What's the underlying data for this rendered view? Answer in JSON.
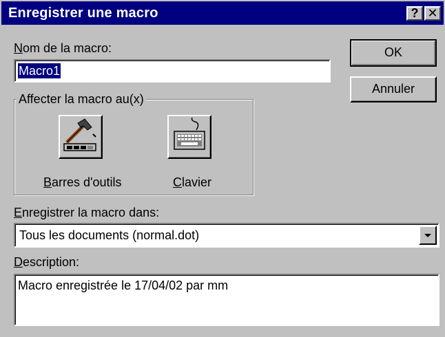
{
  "window": {
    "title": "Enregistrer une macro",
    "help_label": "?",
    "close_label": "✕"
  },
  "macro_name": {
    "label_prefix": "N",
    "label_rest": "om de la macro:",
    "value": "Macro1"
  },
  "buttons": {
    "ok": "OK",
    "cancel": "Annuler"
  },
  "assign_group": {
    "title": "Affecter la macro au(x)",
    "toolbars": {
      "label_prefix": "B",
      "label_rest": "arres d'outils",
      "icon": "hammer-toolbar-icon"
    },
    "keyboard": {
      "label_prefix": "C",
      "label_rest": "lavier",
      "icon": "keyboard-icon"
    }
  },
  "store_in": {
    "label_prefix": "E",
    "label_rest": "nregistrer la macro dans:",
    "value": "Tous les documents (normal.dot)"
  },
  "description": {
    "label_prefix": "D",
    "label_rest": "escription:",
    "value": "Macro enregistrée le 17/04/02 par mm"
  },
  "colors": {
    "title_bar": "#000080",
    "face": "#c0c0c0",
    "selection": "#000080"
  }
}
